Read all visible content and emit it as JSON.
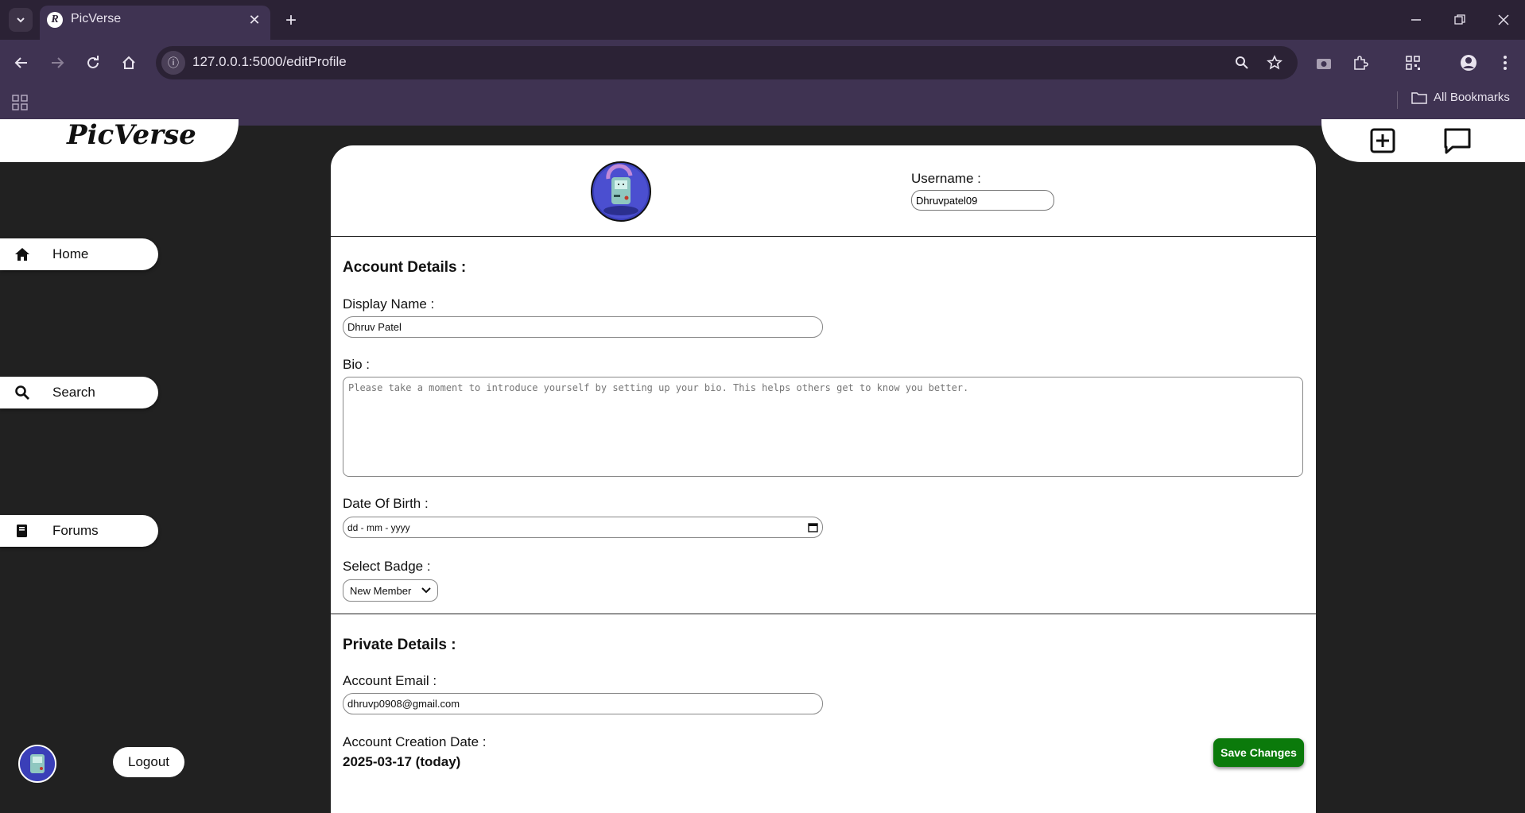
{
  "browser": {
    "tab_title": "PicVerse",
    "tab_favicon_letter": "R",
    "url": "127.0.0.1:5000/editProfile",
    "all_bookmarks_label": "All Bookmarks"
  },
  "app": {
    "logo": "PicVerse"
  },
  "sidebar": {
    "items": [
      {
        "label": "Home",
        "icon": "home-icon"
      },
      {
        "label": "Search",
        "icon": "search-icon"
      },
      {
        "label": "Forums",
        "icon": "book-icon"
      }
    ],
    "logout_label": "Logout"
  },
  "profile": {
    "username_label": "Username :",
    "username_value": "Dhruvpatel09"
  },
  "account_details": {
    "title": "Account Details :",
    "display_name_label": "Display Name :",
    "display_name_value": "Dhruv Patel",
    "bio_label": "Bio :",
    "bio_placeholder": "Please take a moment to introduce yourself by setting up your bio. This helps others get to know you better.",
    "dob_label": "Date Of Birth :",
    "dob_placeholder": "dd - mm - yyyy",
    "badge_label": "Select Badge :",
    "badge_value": "New Member"
  },
  "private_details": {
    "title": "Private Details :",
    "email_label": "Account Email :",
    "email_value": "dhruvp0908@gmail.com",
    "creation_label": "Account Creation Date :",
    "creation_value": "2025-03-17 (today)"
  },
  "actions": {
    "save_label": "Save Changes"
  },
  "colors": {
    "background": "#212121",
    "chrome_dark": "#2b2235",
    "chrome_light": "#3f3352",
    "save_green": "#0b7a0b"
  }
}
